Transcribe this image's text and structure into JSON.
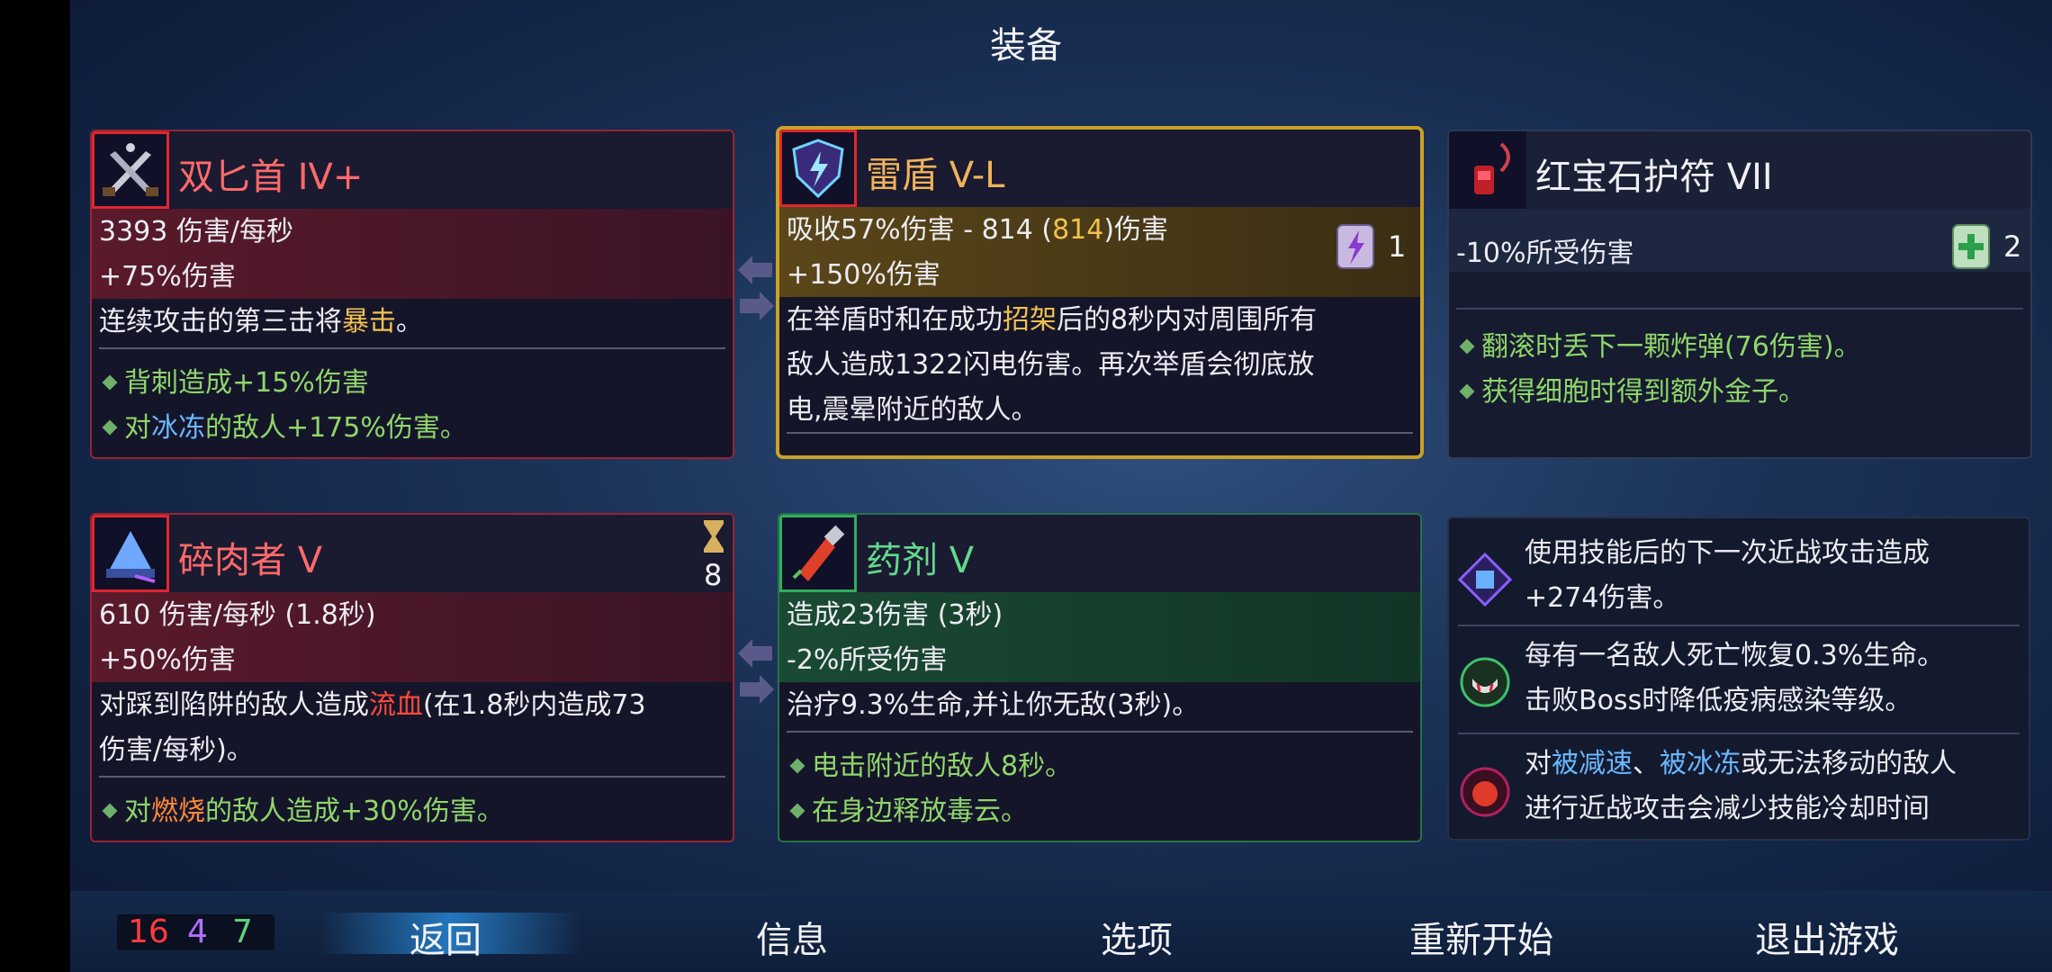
{
  "screen_title": "装备",
  "items": {
    "dual_daggers": {
      "name": "双匕首 IV+",
      "stat1": "3393 伤害/每秒",
      "stat2": "+75%伤害",
      "desc_pre": "连续攻击的第三击将",
      "desc_hl": "暴击",
      "desc_post": "。",
      "mod1": "背刺造成+15%伤害",
      "mod2_pre": "对",
      "mod2_hl": "冰冻",
      "mod2_post": "的敌人+175%伤害。"
    },
    "thunder_shield": {
      "name": "雷盾 V-L",
      "stat1_pre": "吸收57%伤害 - 814 (",
      "stat1_hl": "814",
      "stat1_post": ")伤害",
      "stat2": "+150%伤害",
      "desc1_pre": "在举盾时和在成功",
      "desc1_hl": "招架",
      "desc1_post": "后的8秒内对周围所有",
      "desc2": "敌人造成1322闪电伤害。再次举盾会彻底放",
      "desc3": "电,震晕附近的敌人。",
      "scroll_count": "1"
    },
    "ruby_amulet": {
      "name": "红宝石护符 VII",
      "stat1": "-10%所受伤害",
      "mod1": "翻滚时丢下一颗炸弹(76伤害)。",
      "mod2": "获得细胞时得到额外金子。",
      "scroll_count": "2"
    },
    "meat_grinder": {
      "name": "碎肉者 V",
      "cooldown": "8",
      "stat1": "610 伤害/每秒 (1.8秒)",
      "stat2": "+50%伤害",
      "desc1_pre": "对踩到陷阱的敌人造成",
      "desc1_hl": "流血",
      "desc1_post": "(在1.8秒内造成73",
      "desc2": "伤害/每秒)。",
      "mod1_pre": "对",
      "mod1_hl": "燃烧",
      "mod1_post": "的敌人造成+30%伤害。"
    },
    "potion": {
      "name": "药剂 V",
      "stat1": "造成23伤害 (3秒)",
      "stat2": "-2%所受伤害",
      "desc1": "治疗9.3%生命,并让你无敌(3秒)。",
      "mod1": "电击附近的敌人8秒。",
      "mod2": "在身边释放毒云。"
    }
  },
  "mutations": [
    {
      "line1": "使用技能后的下一次近战攻击造成",
      "line2": "+274伤害。"
    },
    {
      "line1": "每有一名敌人死亡恢复0.3%生命。",
      "line2": "击败Boss时降低疫病感染等级。"
    },
    {
      "line1_pre": "对",
      "line1_hl1": "被减速",
      "line1_mid": "、",
      "line1_hl2": "被冰冻",
      "line1_post": "或无法移动的敌人",
      "line2": "进行近战攻击会减少技能冷却时间"
    }
  ],
  "scrolls": {
    "red": "16",
    "purple": "4",
    "green": "7"
  },
  "colors": {
    "red": "#ff3b3b",
    "purple": "#b070ff",
    "green": "#5fd07a"
  },
  "menu": {
    "back": "返回",
    "info": "信息",
    "options": "选项",
    "restart": "重新开始",
    "quit": "退出游戏"
  }
}
